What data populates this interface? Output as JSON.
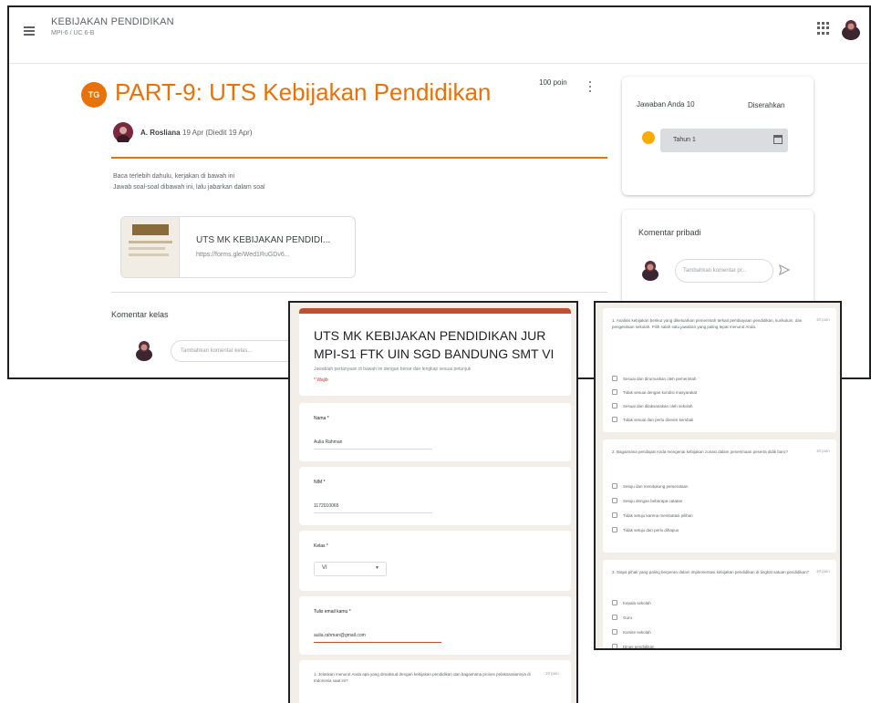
{
  "app": {
    "class_name": "KEBIJAKAN PENDIDIKAN",
    "class_section": "MPI-6 / UC 6-B"
  },
  "assignment": {
    "icon_label": "TG",
    "title": "PART-9: UTS Kebijakan Pendidikan",
    "points": "100 poin",
    "author": "A. Rosliana",
    "date": "19 Apr (Diedit 19 Apr)",
    "instructions": [
      "Baca terlebih dahulu, kerjakan di bawah ini",
      "Jawab soal-soal dibawah ini, lalu jabarkan dalam soal"
    ],
    "attachment": {
      "title": "UTS MK KEBIJAKAN PENDIDI...",
      "url": "https://forms.gle/Wed1RuGDv6..."
    },
    "class_comments_label": "Komentar kelas",
    "class_comment_placeholder": "Tambahkan komentar kelas..."
  },
  "your_work": {
    "title": "Jawaban Anda",
    "badge": "10",
    "status": "Diserahkan",
    "selected": "Tahun 1"
  },
  "private_comments": {
    "title": "Komentar pribadi",
    "placeholder": "Tambahkan komentar pr..."
  },
  "form": {
    "title": "UTS MK KEBIJAKAN PENDIDIKAN JUR MPI-S1 FTK UIN SGD BANDUNG SMT VI",
    "description": "Jawablah pertanyaan di bawah ini dengan benar dan lengkap sesuai petunjuk",
    "required_note": "* Wajib",
    "questions": [
      {
        "label": "Nama *",
        "answer": "Aulia Rahman"
      },
      {
        "label": "NIM *",
        "answer": "1172010065"
      },
      {
        "label": "Kelas *",
        "answer": "VI"
      },
      {
        "label": "Tulis email kamu *",
        "answer": "aulia.rahman@gmail.com"
      }
    ],
    "q5_text": "1. Jelaskan menurut Anda apa yang dimaksud dengan kebijakan pendidikan dan bagaimana proses pelaksanaannya di Indonesia saat ini?",
    "q5_points": "10 poin"
  },
  "questions_panel": [
    {
      "text": "1. Analisis kebijakan berikut yang dikeluarkan pemerintah terkait pembiayaan pendidikan, kurikulum, dan pengelolaan sekolah. Pilih salah satu jawaban yang paling tepat menurut Anda.",
      "points": "10 poin",
      "options": [
        "Sesuai dan dirumuskan oleh pemerintah",
        "Tidak sesuai dengan kondisi masyarakat",
        "Sesuai dan dilaksanakan oleh sekolah",
        "Tidak sesuai dan perlu direvisi kembali"
      ]
    },
    {
      "text": "2. Bagaimana pendapat Anda mengenai kebijakan zonasi dalam penerimaan peserta didik baru?",
      "points": "10 poin",
      "options": [
        "Setuju dan mendukung pemerataan",
        "Setuju dengan beberapa catatan",
        "Tidak setuju karena membatasi pilihan",
        "Tidak setuju dan perlu dihapus"
      ]
    },
    {
      "text": "3. Siapa pihak yang paling berperan dalam implementasi kebijakan pendidikan di tingkat satuan pendidikan?",
      "points": "10 poin",
      "options": [
        "Kepala sekolah",
        "Guru",
        "Komite sekolah",
        "Dinas pendidikan"
      ]
    }
  ],
  "colors": {
    "accent": "#e8710a",
    "form_accent": "#c0512f",
    "form_background": "#f3eee8"
  },
  "icons": [
    "menu-icon",
    "apps-icon",
    "more-vert-icon",
    "send-icon",
    "assignment-icon"
  ]
}
